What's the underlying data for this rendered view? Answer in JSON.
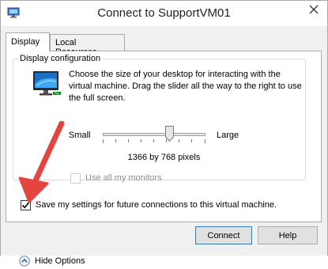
{
  "window": {
    "title": "Connect to SupportVM01",
    "close_glyph": "✕"
  },
  "tabs": [
    {
      "label": "Display",
      "active": true
    },
    {
      "label": "Local Resources",
      "active": false
    }
  ],
  "display": {
    "group_label": "Display configuration",
    "description": "Choose the size of your desktop for interacting with the virtual machine. Drag the slider all the way to the right to use the full screen.",
    "slider_small_label": "Small",
    "slider_large_label": "Large",
    "resolution_text": "1366 by 768 pixels",
    "use_all_monitors_label": "Use all my monitors",
    "use_all_monitors_checked": false,
    "use_all_monitors_enabled": false
  },
  "save_settings": {
    "label": "Save my settings for future connections to this virtual machine.",
    "checked": true
  },
  "footer": {
    "hide_options_label": "Hide Options",
    "connect_label": "Connect",
    "help_label": "Help"
  },
  "colors": {
    "arrow": "#e5453f",
    "window_bg": "#f0f0f0",
    "panel_bg": "#ffffff",
    "accent_border": "#3c7fb1"
  },
  "icons": {
    "window": "vm-connect-icon",
    "monitor": "display-monitor-icon",
    "hide_options": "chevron-up-circle-icon",
    "annotation": "red-arrow-icon"
  }
}
